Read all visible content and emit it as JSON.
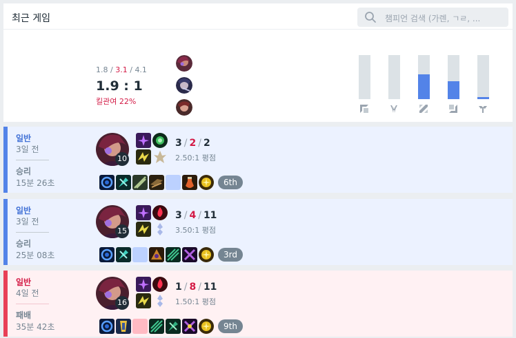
{
  "header": {
    "title": "최근 게임",
    "search_placeholder": "챔피언 검색 (가렌, ㄱㄹ, ..."
  },
  "summary": {
    "kills": "1.8",
    "deaths": "3.1",
    "assists": "4.1",
    "sep": "/",
    "ratio": "1.9 : 1",
    "kill_participation": "킬관여 22%",
    "positions": [
      {
        "name": "top",
        "fraction": 0
      },
      {
        "name": "jungle",
        "fraction": 0
      },
      {
        "name": "mid",
        "fraction": 0.56
      },
      {
        "name": "adc",
        "fraction": 0.41
      },
      {
        "name": "support",
        "fraction": 0.05
      }
    ]
  },
  "matches": [
    {
      "result_type": "win",
      "queue": "일반",
      "time_ago": "3일 전",
      "result": "승리",
      "duration": "15분 26초",
      "level": "10",
      "kills": "3",
      "deaths": "2",
      "assists": "2",
      "kda_ratio": "2.50:1 평점",
      "rank": "6th"
    },
    {
      "result_type": "win",
      "queue": "일반",
      "time_ago": "3일 전",
      "result": "승리",
      "duration": "25분 08초",
      "level": "15",
      "kills": "3",
      "deaths": "4",
      "assists": "11",
      "kda_ratio": "3.50:1 평점",
      "rank": "3rd"
    },
    {
      "result_type": "lose",
      "queue": "일반",
      "time_ago": "4일 전",
      "result": "패배",
      "duration": "35분 42초",
      "level": "16",
      "kills": "1",
      "deaths": "8",
      "assists": "11",
      "kda_ratio": "1.50:1 평점",
      "rank": "9th"
    }
  ],
  "colors": {
    "win_accent": "#5383e8",
    "lose_accent": "#e84057",
    "death": "#d31a45"
  }
}
